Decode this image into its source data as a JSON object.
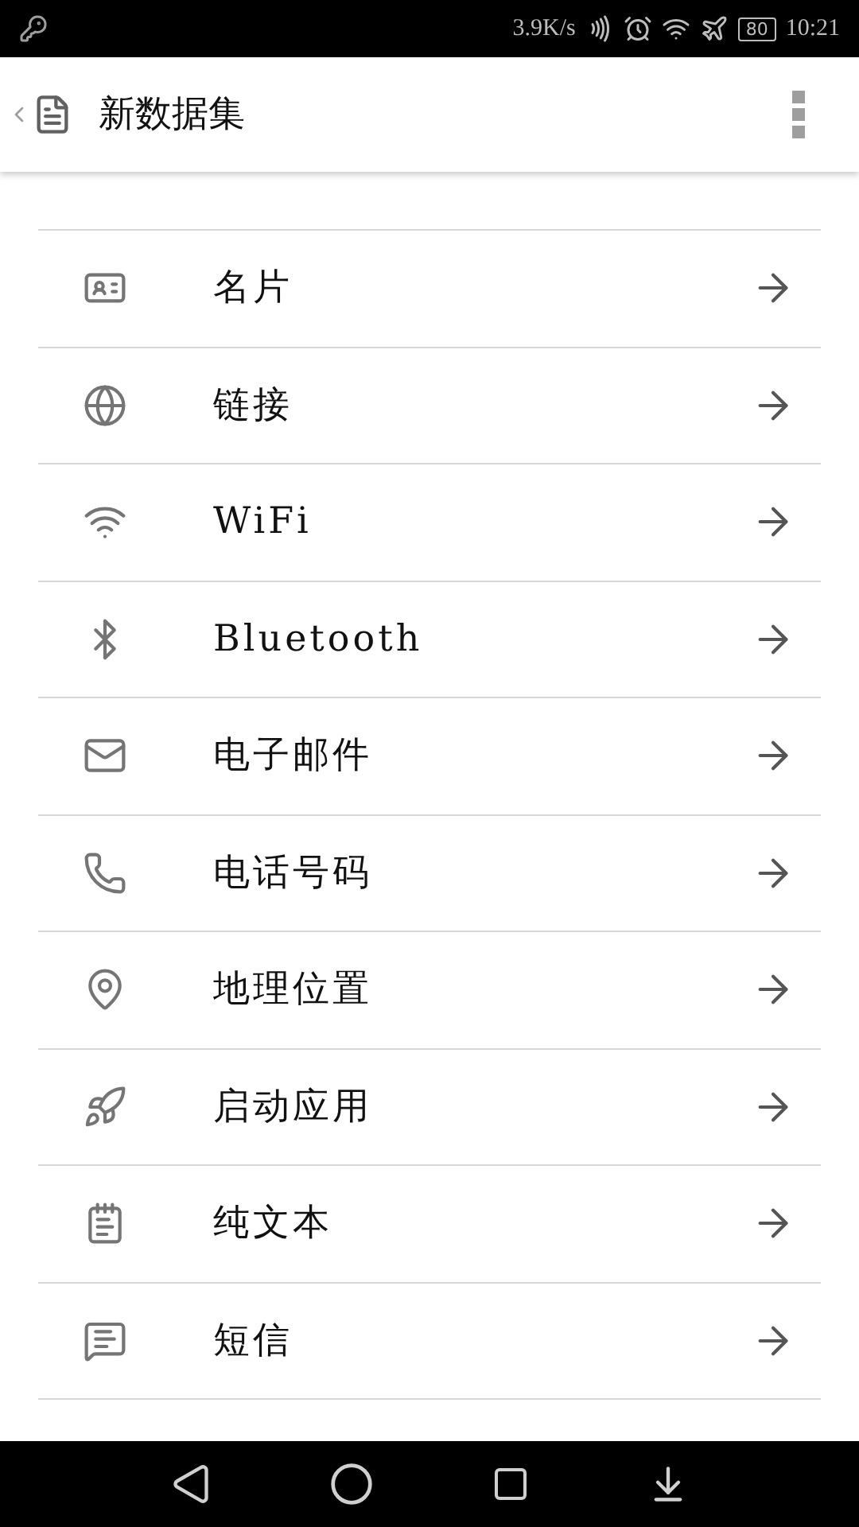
{
  "status_bar": {
    "speed": "3.9K/s",
    "battery": "80",
    "time": "10:21"
  },
  "app_bar": {
    "title": "新数据集"
  },
  "items": [
    {
      "kind": "card",
      "label": "名片"
    },
    {
      "kind": "link",
      "label": "链接"
    },
    {
      "kind": "wifi",
      "label": "WiFi"
    },
    {
      "kind": "bluetooth",
      "label": "Bluetooth"
    },
    {
      "kind": "email",
      "label": "电子邮件"
    },
    {
      "kind": "phone",
      "label": "电话号码"
    },
    {
      "kind": "location",
      "label": "地理位置"
    },
    {
      "kind": "app",
      "label": "启动应用"
    },
    {
      "kind": "text",
      "label": "纯文本"
    },
    {
      "kind": "sms",
      "label": "短信"
    }
  ]
}
